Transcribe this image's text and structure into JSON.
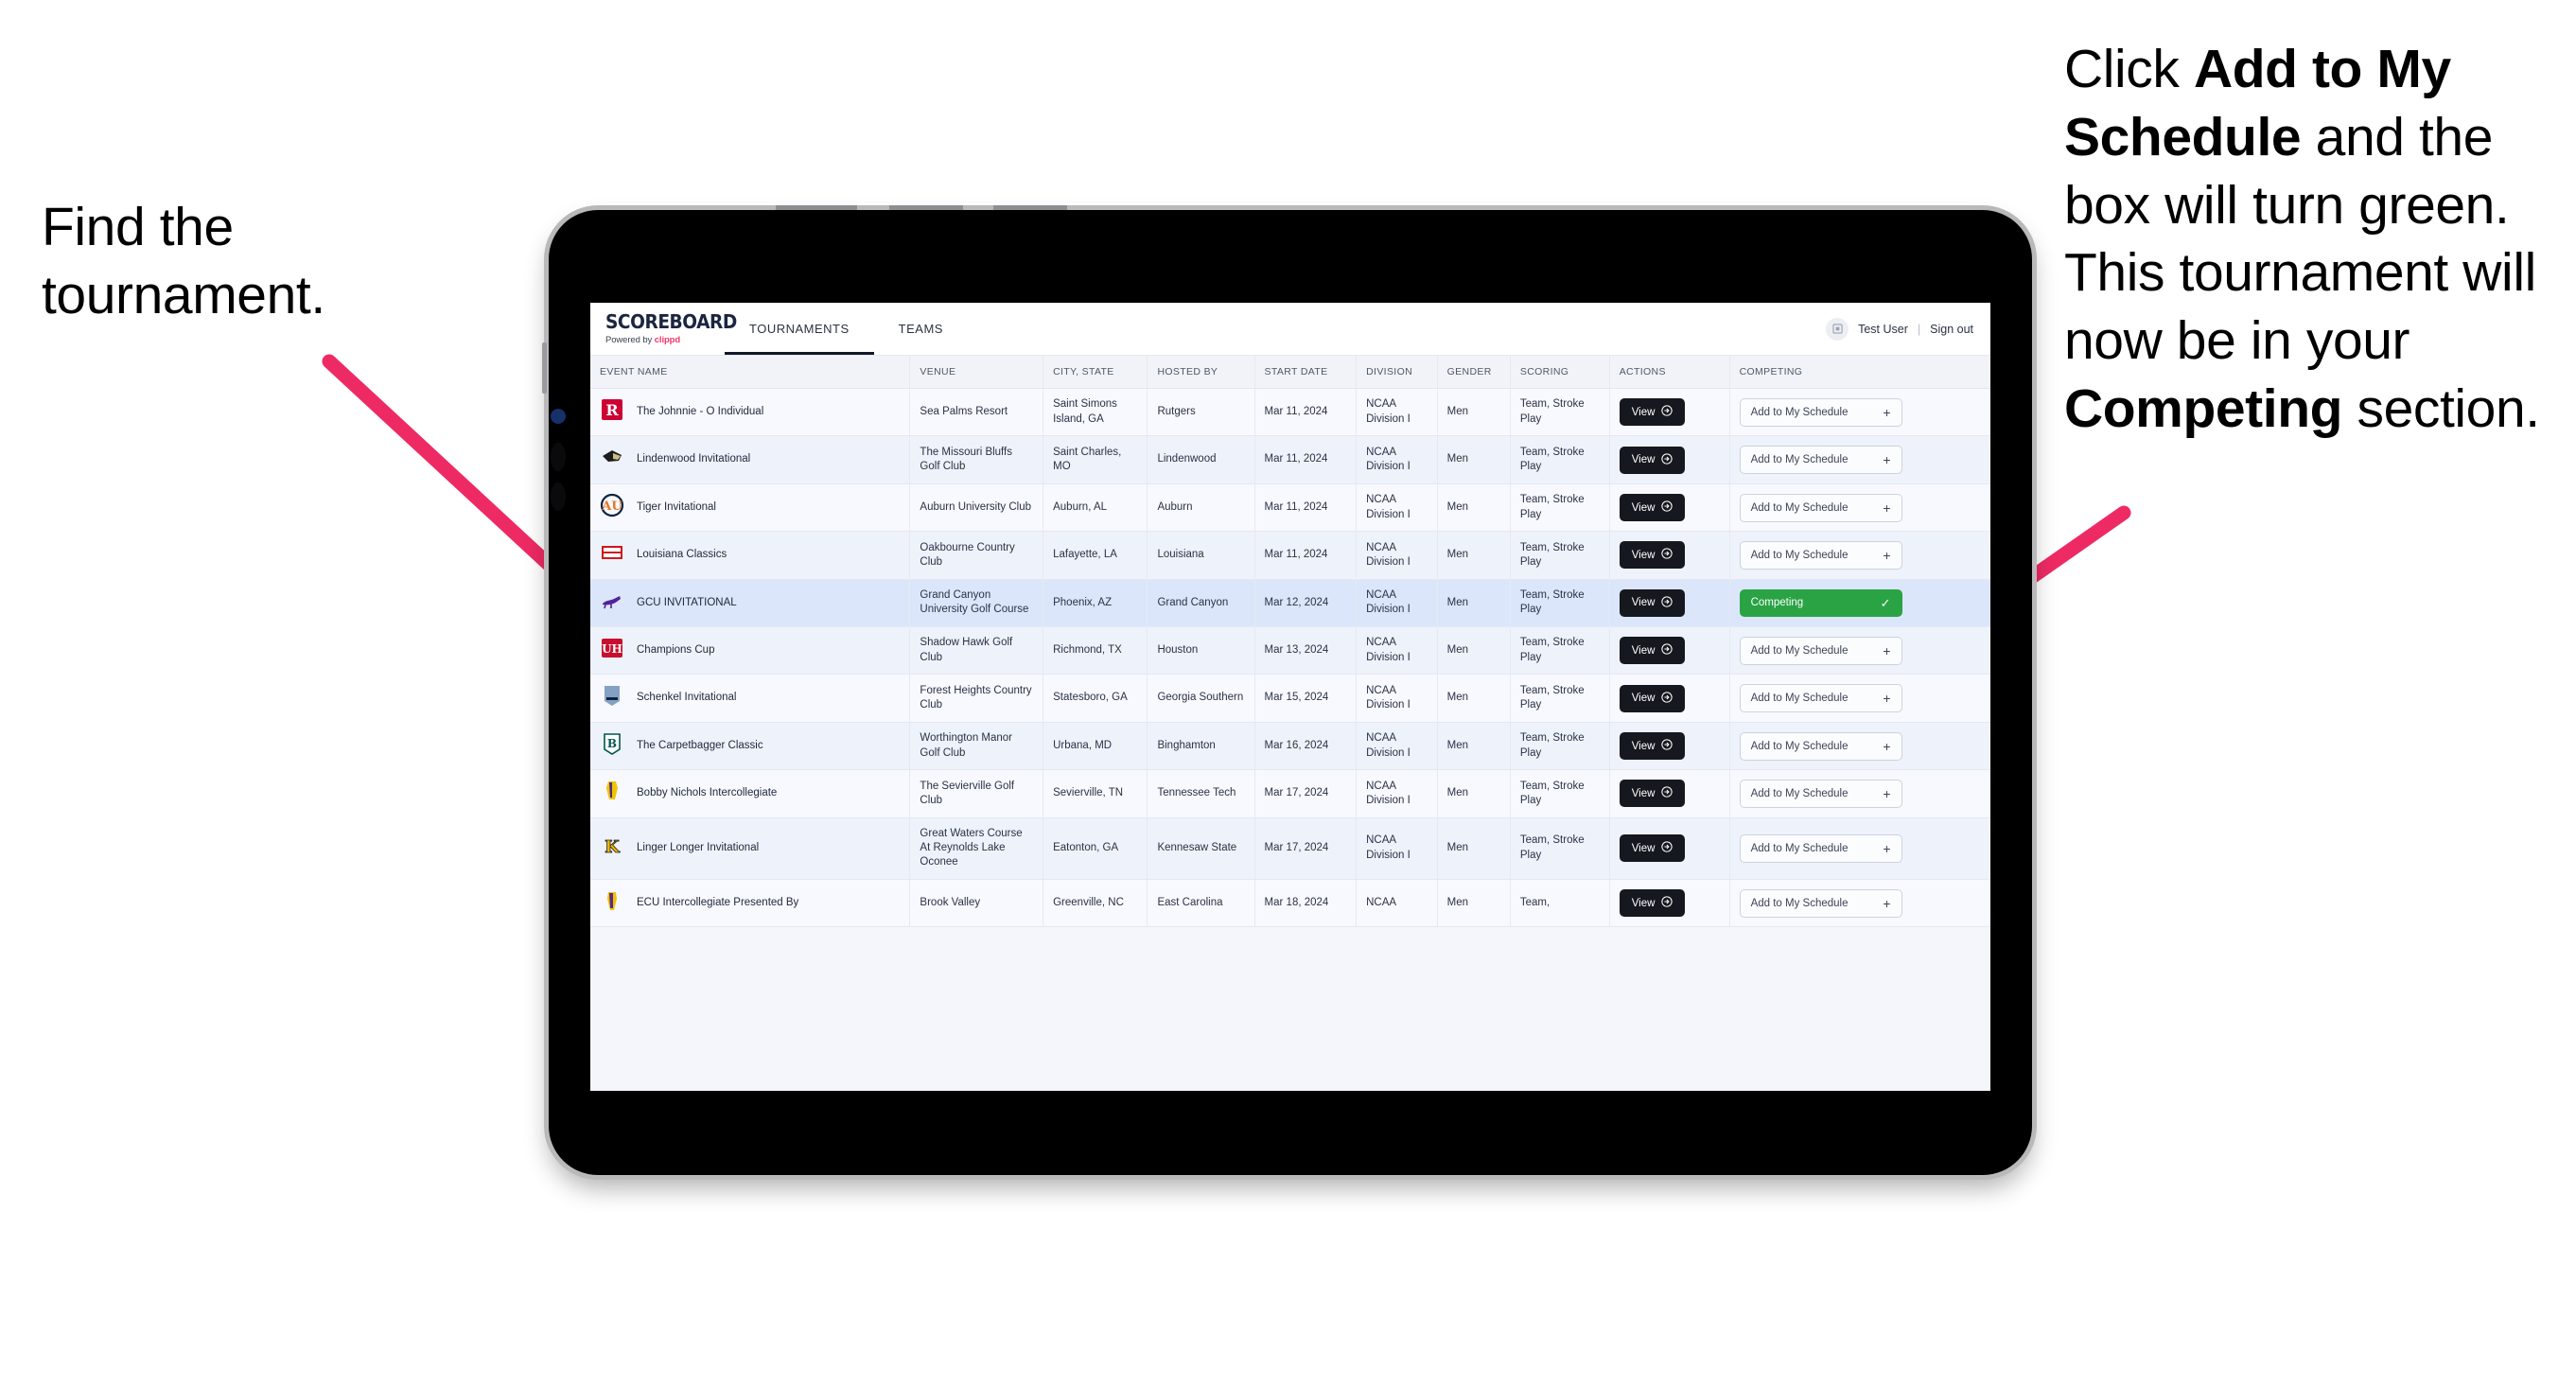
{
  "annotations": {
    "left": {
      "line1": "Find the",
      "line2": "tournament."
    },
    "right": {
      "seg1": "Click ",
      "bold1": "Add to My Schedule",
      "seg2": " and the box will turn green. This tournament will now be in your ",
      "bold2": "Competing",
      "seg3": " section."
    },
    "arrow_color": "#ee2a64"
  },
  "app": {
    "brand": {
      "title": "SCOREBOARD",
      "powered_prefix": "Powered by ",
      "powered_brand": "clippd"
    },
    "nav": [
      {
        "label": "TOURNAMENTS",
        "active": true
      },
      {
        "label": "TEAMS",
        "active": false
      }
    ],
    "user": {
      "avatar_icon": "user-grid-icon",
      "name": "Test User",
      "separator": "|",
      "signout": "Sign out"
    },
    "table": {
      "columns": [
        "EVENT NAME",
        "VENUE",
        "CITY, STATE",
        "HOSTED BY",
        "START DATE",
        "DIVISION",
        "GENDER",
        "SCORING",
        "ACTIONS",
        "COMPETING"
      ],
      "view_label": "View",
      "add_label": "Add to My Schedule",
      "add_icon": "plus-icon",
      "competing_label": "Competing",
      "competing_icon": "check-icon",
      "view_icon": "arrow-right-circle-icon",
      "competing_color": "#2aa344",
      "rows": [
        {
          "logo": "rutgers-r-logo",
          "event": "The Johnnie - O Individual",
          "venue": "Sea Palms Resort",
          "city": "Saint Simons Island, GA",
          "hosted": "Rutgers",
          "date": "Mar 11, 2024",
          "division": "NCAA Division I",
          "gender": "Men",
          "scoring": "Team, Stroke Play",
          "competing": false
        },
        {
          "logo": "lindenwood-lion-logo",
          "event": "Lindenwood Invitational",
          "venue": "The Missouri Bluffs Golf Club",
          "city": "Saint Charles, MO",
          "hosted": "Lindenwood",
          "date": "Mar 11, 2024",
          "division": "NCAA Division I",
          "gender": "Men",
          "scoring": "Team, Stroke Play",
          "competing": false
        },
        {
          "logo": "auburn-au-logo",
          "event": "Tiger Invitational",
          "venue": "Auburn University Club",
          "city": "Auburn, AL",
          "hosted": "Auburn",
          "date": "Mar 11, 2024",
          "division": "NCAA Division I",
          "gender": "Men",
          "scoring": "Team, Stroke Play",
          "competing": false
        },
        {
          "logo": "ragin-cajuns-logo",
          "event": "Louisiana Classics",
          "venue": "Oakbourne Country Club",
          "city": "Lafayette, LA",
          "hosted": "Louisiana",
          "date": "Mar 11, 2024",
          "division": "NCAA Division I",
          "gender": "Men",
          "scoring": "Team, Stroke Play",
          "competing": false
        },
        {
          "logo": "gcu-lope-logo",
          "event": "GCU INVITATIONAL",
          "venue": "Grand Canyon University Golf Course",
          "city": "Phoenix, AZ",
          "hosted": "Grand Canyon",
          "date": "Mar 12, 2024",
          "division": "NCAA Division I",
          "gender": "Men",
          "scoring": "Team, Stroke Play",
          "competing": true
        },
        {
          "logo": "houston-uh-logo",
          "event": "Champions Cup",
          "venue": "Shadow Hawk Golf Club",
          "city": "Richmond, TX",
          "hosted": "Houston",
          "date": "Mar 13, 2024",
          "division": "NCAA Division I",
          "gender": "Men",
          "scoring": "Team, Stroke Play",
          "competing": false
        },
        {
          "logo": "georgia-southern-logo",
          "event": "Schenkel Invitational",
          "venue": "Forest Heights Country Club",
          "city": "Statesboro, GA",
          "hosted": "Georgia Southern",
          "date": "Mar 15, 2024",
          "division": "NCAA Division I",
          "gender": "Men",
          "scoring": "Team, Stroke Play",
          "competing": false
        },
        {
          "logo": "binghamton-b-logo",
          "event": "The Carpetbagger Classic",
          "venue": "Worthington Manor Golf Club",
          "city": "Urbana, MD",
          "hosted": "Binghamton",
          "date": "Mar 16, 2024",
          "division": "NCAA Division I",
          "gender": "Men",
          "scoring": "Team, Stroke Play",
          "competing": false
        },
        {
          "logo": "tennessee-tech-logo",
          "event": "Bobby Nichols Intercollegiate",
          "venue": "The Sevierville Golf Club",
          "city": "Sevierville, TN",
          "hosted": "Tennessee Tech",
          "date": "Mar 17, 2024",
          "division": "NCAA Division I",
          "gender": "Men",
          "scoring": "Team, Stroke Play",
          "competing": false
        },
        {
          "logo": "kennesaw-state-logo",
          "event": "Linger Longer Invitational",
          "venue": "Great Waters Course At Reynolds Lake Oconee",
          "city": "Eatonton, GA",
          "hosted": "Kennesaw State",
          "date": "Mar 17, 2024",
          "division": "NCAA Division I",
          "gender": "Men",
          "scoring": "Team, Stroke Play",
          "competing": false
        },
        {
          "logo": "ecu-pirates-logo",
          "event": "ECU Intercollegiate Presented By",
          "venue": "Brook Valley",
          "city": "Greenville, NC",
          "hosted": "East Carolina",
          "date": "Mar 18, 2024",
          "division": "NCAA",
          "gender": "Men",
          "scoring": "Team,",
          "competing": false
        }
      ]
    }
  }
}
